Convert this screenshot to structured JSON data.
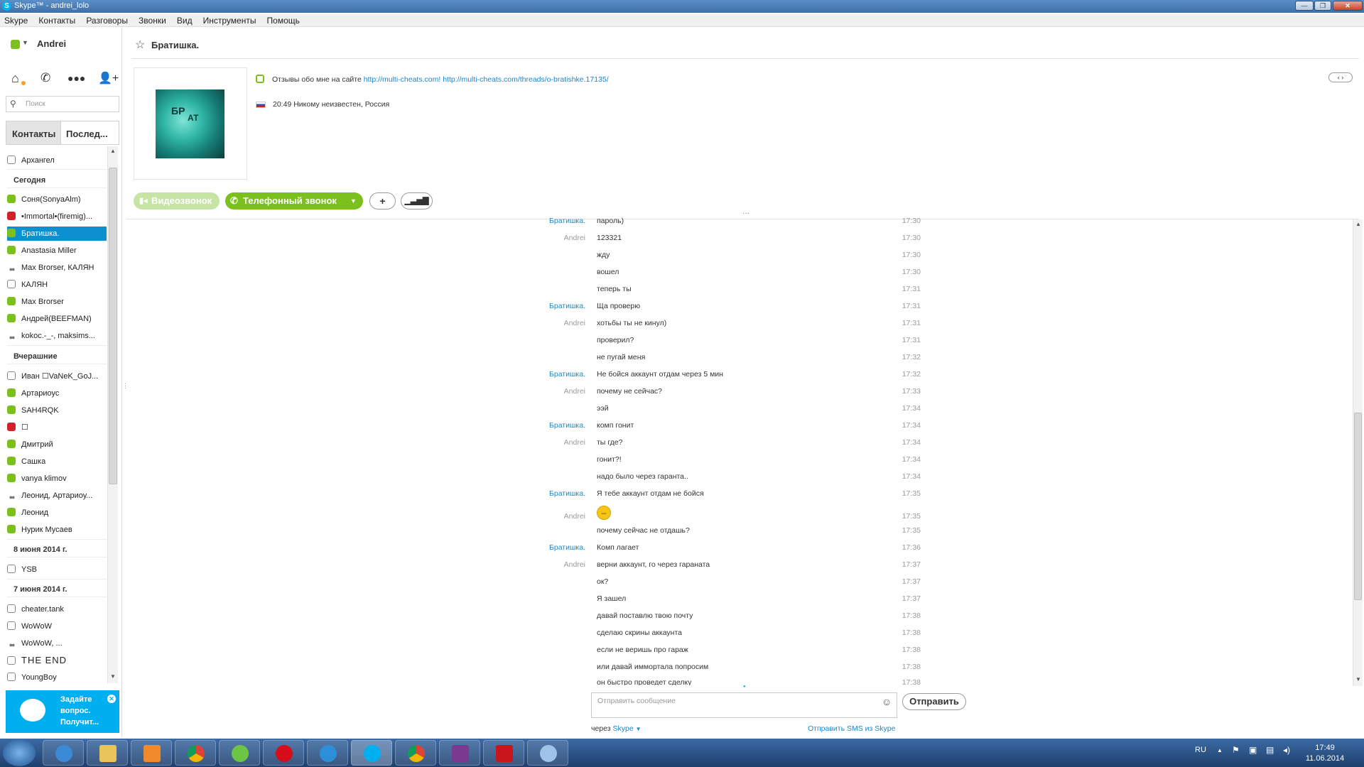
{
  "window": {
    "title": "Skype™ - andrei_lolo",
    "buttons": [
      "—",
      "❐",
      "✕"
    ]
  },
  "menu": [
    "Skype",
    "Контакты",
    "Разговоры",
    "Звонки",
    "Вид",
    "Инструменты",
    "Помощь"
  ],
  "sidebar": {
    "user_name": "Andrei",
    "search_placeholder": "Поиск",
    "tabs": {
      "contacts": "Контакты",
      "recent": "Послед..."
    },
    "top_contact": "Архангел",
    "groups": [
      {
        "title": "Сегодня",
        "items": [
          {
            "name": "Соня(SonyaAlm)",
            "status": "online"
          },
          {
            "name": "•Immortal•(firemig)...",
            "status": "dnd"
          },
          {
            "name": "Братишка.",
            "status": "online",
            "selected": true
          },
          {
            "name": "Anastasia Miller",
            "status": "online"
          },
          {
            "name": "Max Brorser, КАЛЯН",
            "status": "group"
          },
          {
            "name": "КАЛЯН",
            "status": "offline"
          },
          {
            "name": "Max Brorser",
            "status": "online"
          },
          {
            "name": "Андрей(BEEFMAN)",
            "status": "online"
          },
          {
            "name": "kokoc.-_-, maksims...",
            "status": "group"
          }
        ]
      },
      {
        "title": "Вчерашние",
        "items": [
          {
            "name": "Иван ☐VaNeK_GoJ...",
            "status": "offline"
          },
          {
            "name": "Артариоус",
            "status": "online"
          },
          {
            "name": "SAH4RQK",
            "status": "online"
          },
          {
            "name": "☐",
            "status": "dnd"
          },
          {
            "name": "Дмитрий",
            "status": "online"
          },
          {
            "name": "Сашка",
            "status": "online"
          },
          {
            "name": "vanya klimov",
            "status": "online"
          },
          {
            "name": "Леонид, Артариоу...",
            "status": "group"
          },
          {
            "name": "Леонид",
            "status": "online"
          },
          {
            "name": "Нурик Мусаев",
            "status": "online"
          }
        ]
      },
      {
        "title": "8 июня 2014 г.",
        "items": [
          {
            "name": "YSB",
            "status": "offline"
          }
        ]
      },
      {
        "title": "7 июня 2014 г.",
        "items": [
          {
            "name": "cheater.tank",
            "status": "offline"
          },
          {
            "name": "WoWoW",
            "status": "offline"
          },
          {
            "name": "WoWoW, ...",
            "status": "group"
          },
          {
            "name": "THE END",
            "status": "offline"
          },
          {
            "name": "YoungBoy",
            "status": "offline"
          }
        ]
      }
    ],
    "ad": {
      "text1": "Задайте",
      "text2": "вопрос.",
      "text3": "Получит..."
    }
  },
  "chat": {
    "title": "Братишка.",
    "mood_prefix": "Отзывы обо мне на сайте",
    "link1": "http://multi-cheats.com!",
    "link2": "http://multi-cheats.com/threads/o-bratishke.17135/",
    "location": "20:49 Никому неизвестен, Россия",
    "buttons": {
      "video": "Видеозвонок",
      "call": "Телефонный звонок",
      "add": "+"
    },
    "messages": [
      {
        "sender": "Братишка.",
        "text": "пароль)",
        "time": "17:30",
        "who": "bro"
      },
      {
        "sender": "Andrei",
        "text": "123321",
        "time": "17:30",
        "who": "me"
      },
      {
        "sender": "",
        "text": "жду",
        "time": "17:30",
        "who": "me"
      },
      {
        "sender": "",
        "text": "вошел",
        "time": "17:30",
        "who": "me"
      },
      {
        "sender": "",
        "text": "теперь ты",
        "time": "17:31",
        "who": "me"
      },
      {
        "sender": "Братишка.",
        "text": "Ща проверю",
        "time": "17:31",
        "who": "bro"
      },
      {
        "sender": "Andrei",
        "text": "хотьбы ты не кинул)",
        "time": "17:31",
        "who": "me"
      },
      {
        "sender": "",
        "text": "проверил?",
        "time": "17:31",
        "who": "me"
      },
      {
        "sender": "",
        "text": "не пугай меня",
        "time": "17:32",
        "who": "me"
      },
      {
        "sender": "Братишка.",
        "text": "Не бойся аккаунт отдам через 5 мин",
        "time": "17:32",
        "who": "bro"
      },
      {
        "sender": "Andrei",
        "text": "почему не сейчас?",
        "time": "17:33",
        "who": "me"
      },
      {
        "sender": "",
        "text": "ээй",
        "time": "17:34",
        "who": "me"
      },
      {
        "sender": "Братишка.",
        "text": "комп гонит",
        "time": "17:34",
        "who": "bro"
      },
      {
        "sender": "Andrei",
        "text": "ты где?",
        "time": "17:34",
        "who": "me"
      },
      {
        "sender": "",
        "text": "гонит?!",
        "time": "17:34",
        "who": "me"
      },
      {
        "sender": "",
        "text": "надо было через гаранта..",
        "time": "17:34",
        "who": "me"
      },
      {
        "sender": "Братишка.",
        "text": "Я тебе аккаунт отдам не бойся",
        "time": "17:35",
        "who": "bro"
      },
      {
        "sender": "Andrei",
        "text": "😐",
        "time": "17:35",
        "who": "me",
        "emoji": true
      },
      {
        "sender": "",
        "text": "почему сейчас не отдашь?",
        "time": "17:35",
        "who": "me"
      },
      {
        "sender": "Братишка.",
        "text": "Комп лагает",
        "time": "17:36",
        "who": "bro"
      },
      {
        "sender": "Andrei",
        "text": "верни аккаунт, го через гараната",
        "time": "17:37",
        "who": "me"
      },
      {
        "sender": "",
        "text": "ок?",
        "time": "17:37",
        "who": "me"
      },
      {
        "sender": "",
        "text": "Я зашел",
        "time": "17:37",
        "who": "me"
      },
      {
        "sender": "",
        "text": "давай поставлю твою почту",
        "time": "17:38",
        "who": "me"
      },
      {
        "sender": "",
        "text": "сделаю скрины аккаунта",
        "time": "17:38",
        "who": "me"
      },
      {
        "sender": "",
        "text": "если не веришь про гараж",
        "time": "17:38",
        "who": "me"
      },
      {
        "sender": "",
        "text": "или давай иммортала попросим",
        "time": "17:38",
        "who": "me"
      },
      {
        "sender": "",
        "text": "он быстро проведет сделку",
        "time": "17:38",
        "who": "me"
      }
    ],
    "input_placeholder": "Отправить сообщение",
    "send": "Отправить",
    "via": "через",
    "via_service": "Skype",
    "sms_link": "Отправить SMS из Skype"
  },
  "taskbar": {
    "lang": "RU",
    "time": "17:49",
    "date": "11.06.2014"
  },
  "colors": {
    "accent": "#00aff0",
    "green": "#7bc01c",
    "link": "#1a87c9",
    "dnd": "#d31f2a"
  }
}
